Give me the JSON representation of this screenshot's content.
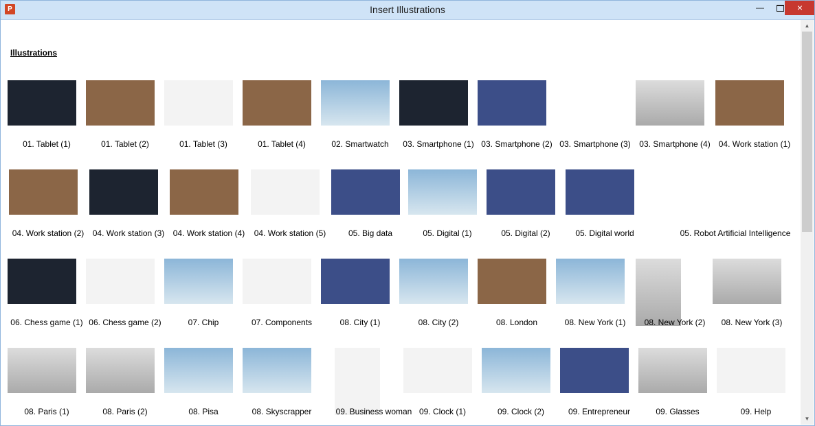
{
  "window": {
    "title": "Insert Illustrations",
    "app_icon": "P",
    "minimize_icon": "minimize-icon",
    "maximize_icon": "maximize-icon",
    "close_icon": "close-icon"
  },
  "heading": "Illustrations",
  "scroll": {
    "up": "▲",
    "down": "▼"
  },
  "items": [
    {
      "label": "01. Tablet (1)"
    },
    {
      "label": "01. Tablet (2)"
    },
    {
      "label": "01. Tablet (3)"
    },
    {
      "label": "01. Tablet (4)"
    },
    {
      "label": "02. Smartwatch"
    },
    {
      "label": "03. Smartphone (1)"
    },
    {
      "label": "03. Smartphone (2)"
    },
    {
      "label": "03. Smartphone (3)"
    },
    {
      "label": "03. Smartphone (4)"
    },
    {
      "label": "04. Work station (1)"
    },
    {
      "label": "04. Work station (2)"
    },
    {
      "label": "04. Work station (3)"
    },
    {
      "label": "04. Work station (4)"
    },
    {
      "label": "04. Work station (5)"
    },
    {
      "label": "05. Big data"
    },
    {
      "label": "05. Digital (1)"
    },
    {
      "label": "05. Digital (2)"
    },
    {
      "label": "05. Digital world"
    },
    {
      "label": "05. Robot Artificial Intelligence"
    },
    {
      "label": "06. Chess game (1)"
    },
    {
      "label": "06. Chess game (2)"
    },
    {
      "label": "07. Chip"
    },
    {
      "label": "07. Components"
    },
    {
      "label": "08. City (1)"
    },
    {
      "label": "08. City (2)"
    },
    {
      "label": "08. London"
    },
    {
      "label": "08. New York (1)"
    },
    {
      "label": "08. New York (2)"
    },
    {
      "label": "08. New York (3)"
    },
    {
      "label": "08. Paris (1)"
    },
    {
      "label": "08. Paris (2)"
    },
    {
      "label": "08. Pisa"
    },
    {
      "label": "08. Skyscrapper"
    },
    {
      "label": "09. Business woman"
    },
    {
      "label": "09. Clock (1)"
    },
    {
      "label": "09. Clock (2)"
    },
    {
      "label": "09. Entrepreneur"
    },
    {
      "label": "09. Glasses"
    },
    {
      "label": "09. Help"
    }
  ]
}
